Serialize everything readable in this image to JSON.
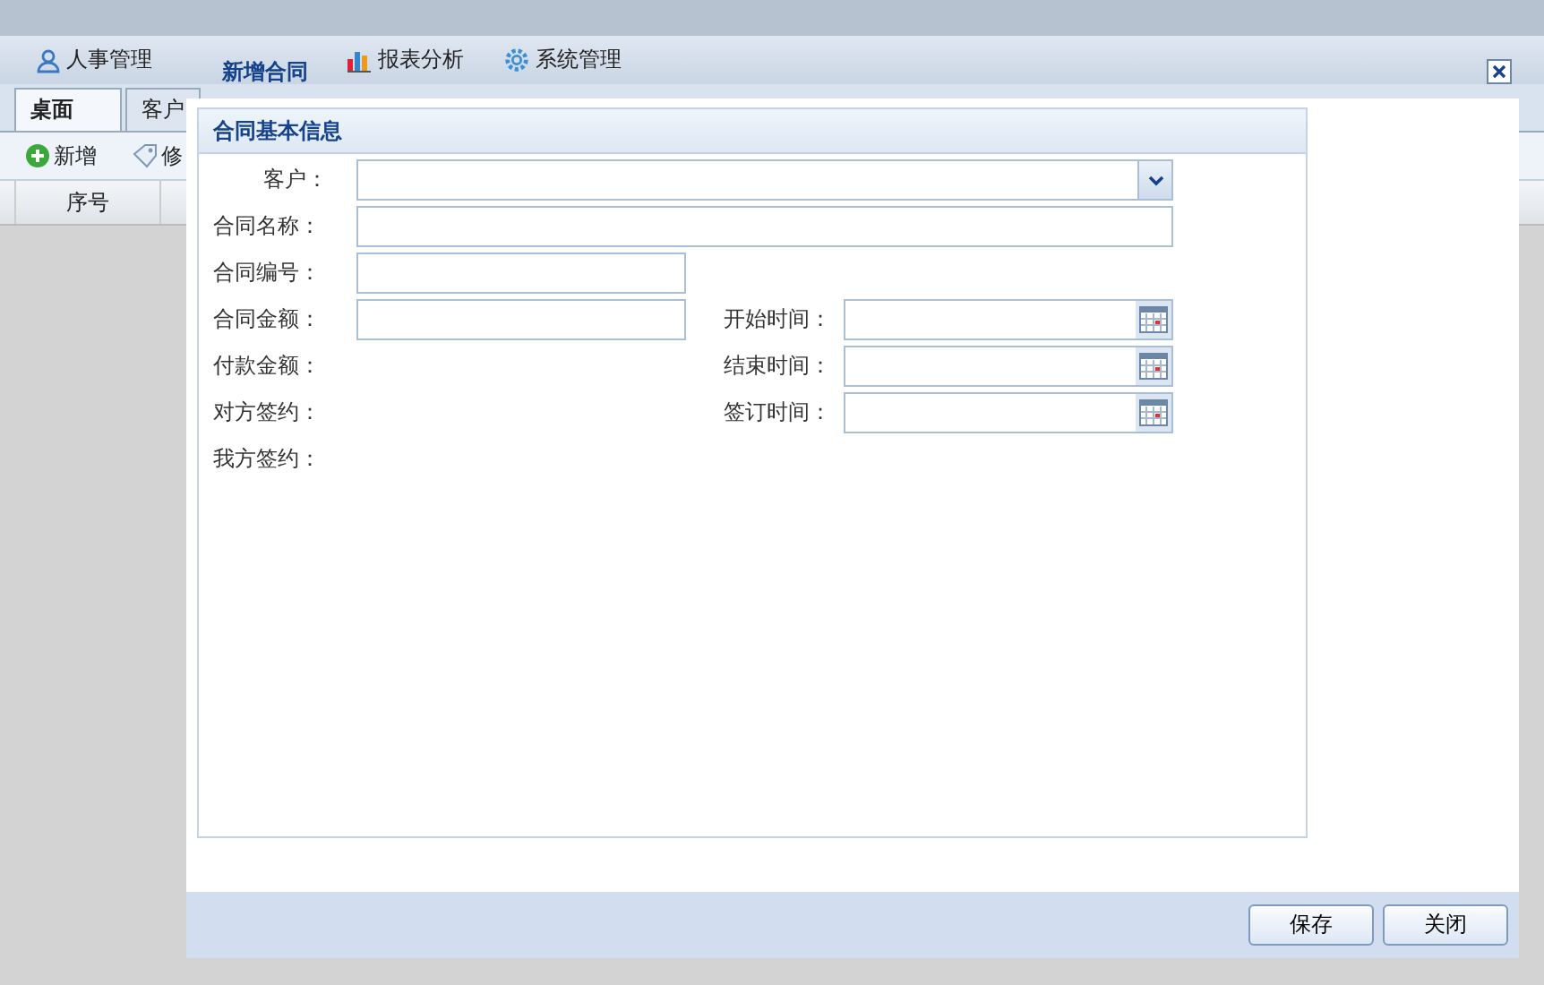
{
  "menu": [
    {
      "label": "人事管理"
    },
    {
      "label": "报表分析"
    },
    {
      "label": "系统管理"
    }
  ],
  "tabs": [
    {
      "label": "桌面",
      "selected": true
    },
    {
      "label": "客户",
      "selected": false
    }
  ],
  "toolbar": [
    {
      "label": "新增"
    },
    {
      "label": "修"
    }
  ],
  "grid": {
    "columns": [
      "序号"
    ]
  },
  "dialog": {
    "title": "新增合同",
    "section": "合同基本信息",
    "rows": [
      {
        "left": {
          "label": "客户：",
          "kind": "combo"
        }
      },
      {
        "left": {
          "label": "合同名称：",
          "kind": "wide"
        }
      },
      {
        "left": {
          "label": "合同编号：",
          "kind": "text"
        }
      },
      {
        "left": {
          "label": "合同金额：",
          "kind": "text"
        },
        "right": {
          "label": "开始时间：",
          "kind": "date"
        }
      },
      {
        "left": {
          "label": "付款金额：",
          "kind": "none"
        },
        "right": {
          "label": "结束时间：",
          "kind": "date"
        }
      },
      {
        "left": {
          "label": "对方签约：",
          "kind": "none"
        },
        "right": {
          "label": "签订时间：",
          "kind": "date"
        }
      },
      {
        "left": {
          "label": "我方签约：",
          "kind": "none"
        }
      }
    ],
    "buttons": [
      "保存",
      "关闭"
    ]
  }
}
